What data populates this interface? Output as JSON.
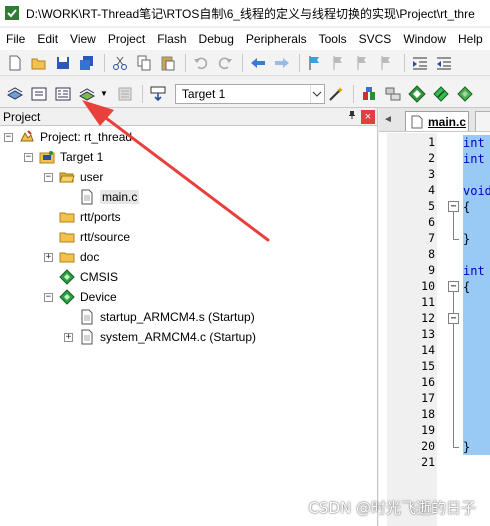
{
  "window": {
    "title": "D:\\WORK\\RT-Thread笔记\\RTOS自制\\6_线程的定义与线程切换的实现\\Project\\rt_thre"
  },
  "menu": [
    "File",
    "Edit",
    "View",
    "Project",
    "Flash",
    "Debug",
    "Peripherals",
    "Tools",
    "SVCS",
    "Window",
    "Help"
  ],
  "toolbar1": {
    "icons": [
      "new-file-icon",
      "open-folder-icon",
      "save-icon",
      "save-all-icon",
      "cut-icon",
      "copy-icon",
      "paste-icon",
      "undo-icon",
      "redo-icon",
      "nav-back-icon",
      "nav-forward-icon",
      "bookmark-icon",
      "prev-bookmark-icon",
      "next-bookmark-icon",
      "clear-bookmarks-icon",
      "indent-icon",
      "unindent-icon"
    ]
  },
  "toolbar2": {
    "target_value": "Target 1",
    "icons": [
      "translate-icon",
      "build-icon",
      "rebuild-icon",
      "batch-build-icon",
      "stop-build-icon",
      "download-icon",
      "magic-wand-icon",
      "manage-components-icon",
      "select-packs-icon",
      "pack-installer-icon",
      "options-icon",
      "green-diamond-icon"
    ]
  },
  "project_panel": {
    "title": "Project",
    "pin": "ª",
    "close": "×"
  },
  "tree": [
    {
      "label": "Project: rt_thread",
      "icon": "project-icon",
      "expander": "−"
    },
    {
      "label": "Target 1",
      "icon": "target-icon",
      "expander": "−"
    },
    {
      "label": "user",
      "icon": "folder-open-icon",
      "expander": "−"
    },
    {
      "label": "main.c",
      "icon": "file-icon",
      "expander": ""
    },
    {
      "label": "rtt/ports",
      "icon": "folder-icon",
      "expander": ""
    },
    {
      "label": "rtt/source",
      "icon": "folder-icon",
      "expander": ""
    },
    {
      "label": "doc",
      "icon": "folder-icon",
      "expander": "+"
    },
    {
      "label": "CMSIS",
      "icon": "green-diamond-icon",
      "expander": ""
    },
    {
      "label": "Device",
      "icon": "green-diamond-icon",
      "expander": "−"
    },
    {
      "label": "startup_ARMCM4.s (Startup)",
      "icon": "file-icon",
      "expander": ""
    },
    {
      "label": "system_ARMCM4.c (Startup)",
      "icon": "file-icon",
      "expander": "+"
    }
  ],
  "editor": {
    "tab_label": "main.c",
    "tab_scroll": "◄",
    "lines": [
      {
        "num": "1",
        "text": "int",
        "fold": ""
      },
      {
        "num": "2",
        "text": "int",
        "fold": ""
      },
      {
        "num": "3",
        "text": "",
        "fold": ""
      },
      {
        "num": "4",
        "text": "void",
        "fold": ""
      },
      {
        "num": "5",
        "text": "{",
        "fold": "−"
      },
      {
        "num": "6",
        "text": "",
        "fold": ""
      },
      {
        "num": "7",
        "text": "}",
        "fold": ""
      },
      {
        "num": "8",
        "text": "",
        "fold": ""
      },
      {
        "num": "9",
        "text": "int",
        "fold": ""
      },
      {
        "num": "10",
        "text": "{",
        "fold": "−"
      },
      {
        "num": "11",
        "text": "",
        "fold": ""
      },
      {
        "num": "12",
        "text": "",
        "fold": "−"
      },
      {
        "num": "13",
        "text": "",
        "fold": ""
      },
      {
        "num": "14",
        "text": "",
        "fold": ""
      },
      {
        "num": "15",
        "text": "",
        "fold": ""
      },
      {
        "num": "16",
        "text": "",
        "fold": ""
      },
      {
        "num": "17",
        "text": "",
        "fold": ""
      },
      {
        "num": "18",
        "text": "",
        "fold": ""
      },
      {
        "num": "19",
        "text": "",
        "fold": ""
      },
      {
        "num": "20",
        "text": "}",
        "fold": ""
      },
      {
        "num": "21",
        "text": "",
        "fold": ""
      }
    ]
  },
  "watermark": "CSDN @时光飞逝的日子",
  "colors": {
    "annotation_arrow": "#e8403a",
    "selection_highlight": "#99c9f5",
    "keyword": "#0000c0"
  }
}
